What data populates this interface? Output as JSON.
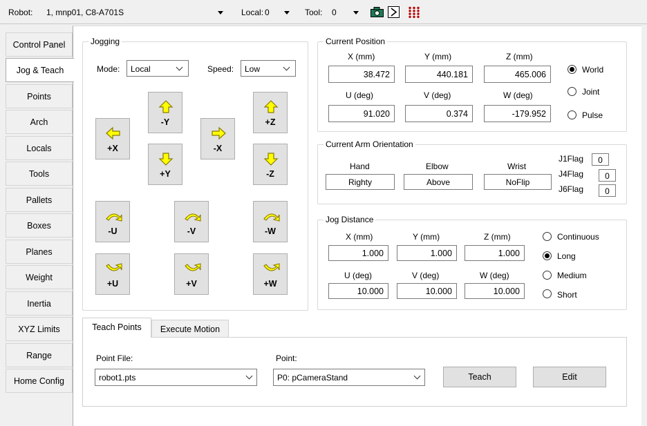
{
  "toolbar": {
    "robot_label": "Robot:",
    "robot_value": "1, mnp01, C8-A701S",
    "local_label": "Local:",
    "local_value": "0",
    "tool_label": "Tool:",
    "tool_value": "0",
    "icons": [
      "camera-icon",
      "play-icon",
      "io-grid-icon"
    ]
  },
  "sidebar": {
    "tabs": [
      "Control Panel",
      "Jog & Teach",
      "Points",
      "Arch",
      "Locals",
      "Tools",
      "Pallets",
      "Boxes",
      "Planes",
      "Weight",
      "Inertia",
      "XYZ Limits",
      "Range",
      "Home Config"
    ],
    "active": "Jog & Teach"
  },
  "jogging": {
    "title": "Jogging",
    "mode_label": "Mode:",
    "mode_value": "Local",
    "speed_label": "Speed:",
    "speed_value": "Low",
    "buttons": {
      "neg_y": "-Y",
      "pos_y": "+Y",
      "pos_x": "+X",
      "neg_x": "-X",
      "pos_z": "+Z",
      "neg_z": "-Z",
      "neg_u": "-U",
      "neg_v": "-V",
      "neg_w": "-W",
      "pos_u": "+U",
      "pos_v": "+V",
      "pos_w": "+W"
    }
  },
  "current_position": {
    "title": "Current Position",
    "labels": {
      "x": "X (mm)",
      "y": "Y (mm)",
      "z": "Z (mm)",
      "u": "U (deg)",
      "v": "V (deg)",
      "w": "W (deg)"
    },
    "values": {
      "x": "38.472",
      "y": "440.181",
      "z": "465.006",
      "u": "91.020",
      "v": "0.374",
      "w": "-179.952"
    },
    "modes": [
      "World",
      "Joint",
      "Pulse"
    ],
    "selected_mode": "World"
  },
  "arm_orientation": {
    "title": "Current Arm Orientation",
    "hand_label": "Hand",
    "hand_value": "Righty",
    "elbow_label": "Elbow",
    "elbow_value": "Above",
    "wrist_label": "Wrist",
    "wrist_value": "NoFlip",
    "j1flag_label": "J1Flag",
    "j1flag_value": "0",
    "j4flag_label": "J4Flag",
    "j4flag_value": "0",
    "j6flag_label": "J6Flag",
    "j6flag_value": "0"
  },
  "jog_distance": {
    "title": "Jog Distance",
    "labels": {
      "x": "X (mm)",
      "y": "Y (mm)",
      "z": "Z (mm)",
      "u": "U (deg)",
      "v": "V (deg)",
      "w": "W (deg)"
    },
    "values": {
      "x": "1.000",
      "y": "1.000",
      "z": "1.000",
      "u": "10.000",
      "v": "10.000",
      "w": "10.000"
    },
    "modes": [
      "Continuous",
      "Long",
      "Medium",
      "Short"
    ],
    "selected_mode": "Long"
  },
  "teach": {
    "tabs": [
      "Teach Points",
      "Execute Motion"
    ],
    "active_tab": "Teach Points",
    "point_file_label": "Point File:",
    "point_file_value": "robot1.pts",
    "point_label": "Point:",
    "point_value": "P0: pCameraStand",
    "teach_button": "Teach",
    "edit_button": "Edit"
  },
  "colors": {
    "arrow_fill": "#ffff00",
    "arrow_stroke": "#8a7a00",
    "button_face": "#e1e1e1"
  }
}
